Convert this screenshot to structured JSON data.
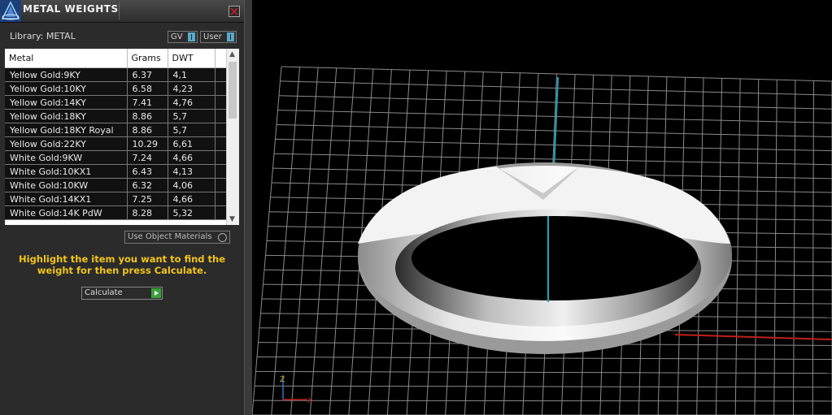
{
  "window": {
    "title": "METAL WEIGHTS",
    "close_icon": "close-icon",
    "logo_icon": "pyramid-logo-icon"
  },
  "library": {
    "label": "Library: METAL",
    "toggle_gv": "GV",
    "toggle_user": "User"
  },
  "table": {
    "columns": [
      "Metal",
      "Grams",
      "DWT"
    ],
    "rows": [
      {
        "metal": "Yellow Gold:9KY",
        "grams": "6.37",
        "dwt": "4,1"
      },
      {
        "metal": "Yellow Gold:10KY",
        "grams": "6.58",
        "dwt": "4,23"
      },
      {
        "metal": "Yellow Gold:14KY",
        "grams": "7.41",
        "dwt": "4,76"
      },
      {
        "metal": "Yellow Gold:18KY",
        "grams": "8.86",
        "dwt": "5,7"
      },
      {
        "metal": "Yellow Gold:18KY Royal",
        "grams": "8.86",
        "dwt": "5,7"
      },
      {
        "metal": "Yellow Gold:22KY",
        "grams": "10.29",
        "dwt": "6,61"
      },
      {
        "metal": "White Gold:9KW",
        "grams": "7.24",
        "dwt": "4,66"
      },
      {
        "metal": "White Gold:10KX1",
        "grams": "6.43",
        "dwt": "4,13"
      },
      {
        "metal": "White Gold:10KW",
        "grams": "6.32",
        "dwt": "4,06"
      },
      {
        "metal": "White Gold:14KX1",
        "grams": "7.25",
        "dwt": "4,66"
      },
      {
        "metal": "White Gold:14K PdW",
        "grams": "8.28",
        "dwt": "5,32"
      }
    ]
  },
  "controls": {
    "use_object_materials": "Use Object Materials",
    "hint": "Highlight the item you want to find the weight for then press Calculate.",
    "calculate": "Calculate"
  },
  "viewport": {
    "axis_labels": {
      "x": "X",
      "z": "Z"
    },
    "colors": {
      "grid": "#8a8a8a",
      "y_axis": "#1fa3b8",
      "x_axis": "#c0201a",
      "accent": "#f2c41a"
    }
  }
}
